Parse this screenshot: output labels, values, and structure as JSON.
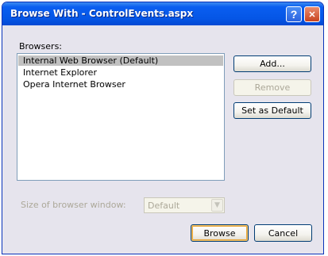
{
  "window": {
    "title": "Browse With - ControlEvents.aspx",
    "help_glyph": "?",
    "close_glyph": "✕"
  },
  "browsers": {
    "label": "Browsers:",
    "items": [
      {
        "label": "Internal Web Browser (Default)",
        "selected": true
      },
      {
        "label": "Internet Explorer",
        "selected": false
      },
      {
        "label": "Opera Internet Browser",
        "selected": false
      }
    ]
  },
  "side_buttons": {
    "add": "Add...",
    "remove": "Remove",
    "set_default": "Set as Default"
  },
  "size": {
    "label": "Size of browser window:",
    "value": "Default",
    "arrow_glyph": "▼"
  },
  "footer": {
    "browse": "Browse",
    "cancel": "Cancel"
  },
  "colors": {
    "titlebar": "#0556e6",
    "selection": "#c1c1c1",
    "dialog_bg": "#ece9d8"
  }
}
